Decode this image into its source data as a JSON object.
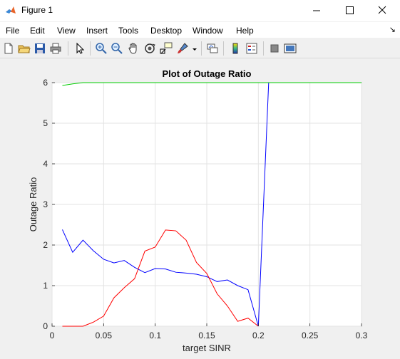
{
  "window": {
    "title": "Figure 1"
  },
  "menu": [
    "File",
    "Edit",
    "View",
    "Insert",
    "Tools",
    "Desktop",
    "Window",
    "Help"
  ],
  "toolbar": [
    {
      "name": "new-figure-icon"
    },
    {
      "name": "open-file-icon"
    },
    {
      "name": "save-icon"
    },
    {
      "name": "print-icon"
    },
    {
      "name": "edit-plot-arrow-icon"
    },
    {
      "name": "zoom-in-icon"
    },
    {
      "name": "zoom-out-icon"
    },
    {
      "name": "pan-hand-icon"
    },
    {
      "name": "rotate-3d-icon"
    },
    {
      "name": "data-cursor-icon"
    },
    {
      "name": "brush-icon"
    },
    {
      "name": "link-plot-icon"
    },
    {
      "name": "colorbar-icon"
    },
    {
      "name": "legend-icon"
    },
    {
      "name": "hide-plot-tools-icon"
    },
    {
      "name": "show-plot-tools-icon"
    }
  ],
  "chart_data": {
    "type": "line",
    "title": "Plot of Outage Ratio",
    "xlabel": "target SINR",
    "ylabel": "Outage Ratio",
    "xlim": [
      0,
      0.3
    ],
    "ylim": [
      0,
      6
    ],
    "xticks": [
      "0",
      "0.05",
      "0.1",
      "0.15",
      "0.2",
      "0.25",
      "0.3"
    ],
    "yticks": [
      "0",
      "1",
      "2",
      "3",
      "4",
      "5",
      "6"
    ],
    "grid": true,
    "series": [
      {
        "color": "#0000ff",
        "x": [
          0.01,
          0.02,
          0.03,
          0.04,
          0.05,
          0.06,
          0.07,
          0.08,
          0.09,
          0.1,
          0.11,
          0.12,
          0.13,
          0.14,
          0.15,
          0.16,
          0.17,
          0.18,
          0.19,
          0.2,
          0.21,
          0.22,
          0.23,
          0.24,
          0.25,
          0.26,
          0.27,
          0.28,
          0.29,
          0.3
        ],
        "y": [
          2.38,
          1.82,
          2.12,
          1.86,
          1.65,
          1.56,
          1.62,
          1.45,
          1.32,
          1.42,
          1.41,
          1.33,
          1.31,
          1.28,
          1.22,
          1.1,
          1.14,
          1.0,
          0.9,
          0.0,
          6.0,
          6.0,
          6.0,
          6.0,
          6.0,
          6.0,
          6.0,
          6.0,
          6.0,
          6.0
        ]
      },
      {
        "color": "#ff0000",
        "x": [
          0.01,
          0.02,
          0.03,
          0.04,
          0.05,
          0.06,
          0.07,
          0.08,
          0.09,
          0.1,
          0.11,
          0.12,
          0.13,
          0.14,
          0.15,
          0.16,
          0.17,
          0.18,
          0.19,
          0.2
        ],
        "y": [
          0.0,
          0.0,
          0.0,
          0.1,
          0.25,
          0.7,
          0.95,
          1.17,
          1.85,
          1.95,
          2.37,
          2.35,
          2.12,
          1.57,
          1.3,
          0.8,
          0.5,
          0.12,
          0.2,
          0.0
        ]
      },
      {
        "color": "#00cc00",
        "x": [
          0.01,
          0.02,
          0.03,
          0.04,
          0.05,
          0.1,
          0.15,
          0.2,
          0.25,
          0.3
        ],
        "y": [
          5.93,
          5.97,
          6.0,
          6.0,
          6.0,
          6.0,
          6.0,
          6.0,
          6.0,
          6.0
        ]
      }
    ]
  }
}
